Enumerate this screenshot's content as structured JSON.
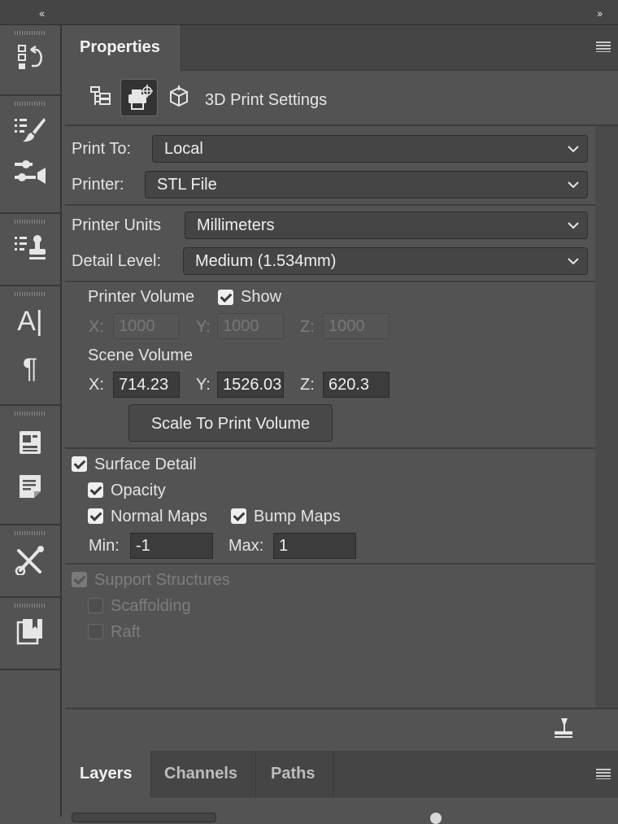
{
  "topbar": {
    "collapse_left": "‹‹",
    "collapse_right": "››"
  },
  "sidebar": {
    "icons": [
      "history-icon",
      "brush-settings-icon",
      "adjustments-icon",
      "clone-source-icon",
      "character-icon",
      "paragraph-icon",
      "properties-icon",
      "notes-icon",
      "tools-icon",
      "libraries-icon"
    ],
    "character_glyph": "A|",
    "paragraph_glyph": "¶"
  },
  "properties": {
    "tab_label": "Properties",
    "mode_title": "3D Print Settings",
    "print_to": {
      "label": "Print To:",
      "value": "Local"
    },
    "printer": {
      "label": "Printer:",
      "value": "STL File"
    },
    "printer_units": {
      "label": "Printer Units",
      "value": "Millimeters"
    },
    "detail_level": {
      "label": "Detail Level:",
      "value": "Medium (1.534mm)"
    },
    "printer_volume": {
      "label": "Printer Volume",
      "show_label": "Show",
      "show_checked": true,
      "x_label": "X:",
      "x": "1000",
      "y_label": "Y:",
      "y": "1000",
      "z_label": "Z:",
      "z": "1000"
    },
    "scene_volume": {
      "label": "Scene Volume",
      "x_label": "X:",
      "x": "714.23",
      "y_label": "Y:",
      "y": "1526.03",
      "z_label": "Z:",
      "z": "620.3"
    },
    "scale_button": "Scale To Print Volume",
    "surface_detail": {
      "label": "Surface Detail",
      "checked": true
    },
    "opacity": {
      "label": "Opacity",
      "checked": true
    },
    "normal_maps": {
      "label": "Normal Maps",
      "checked": true
    },
    "bump_maps": {
      "label": "Bump Maps",
      "checked": true
    },
    "min": {
      "label": "Min:",
      "value": "-1"
    },
    "max": {
      "label": "Max:",
      "value": "1"
    },
    "support_structures": {
      "label": "Support Structures",
      "checked": true,
      "enabled": false
    },
    "scaffolding": {
      "label": "Scaffolding",
      "checked": false,
      "enabled": false
    },
    "raft": {
      "label": "Raft",
      "checked": false,
      "enabled": false
    }
  },
  "layers_panel": {
    "tabs": [
      "Layers",
      "Channels",
      "Paths"
    ],
    "active_tab": "Layers"
  }
}
